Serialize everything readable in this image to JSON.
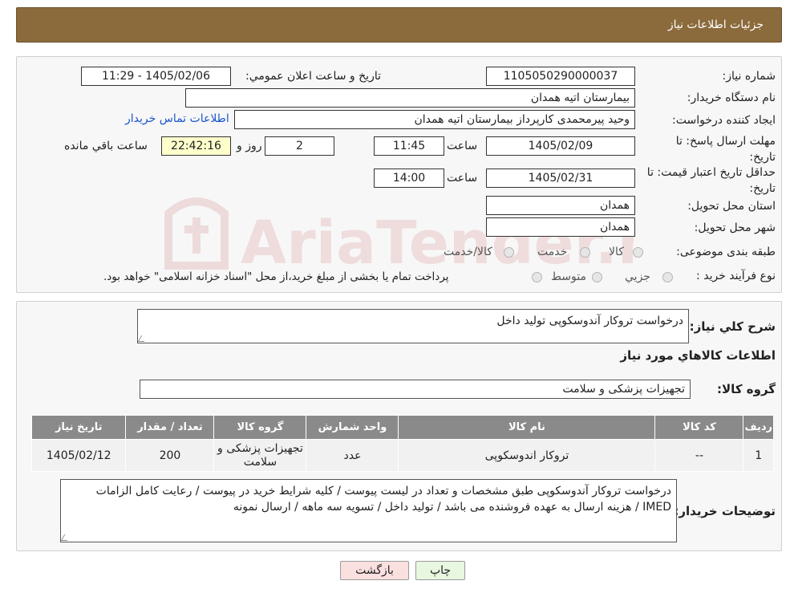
{
  "header": {
    "title": "جزئیات اطلاعات نیاز"
  },
  "form": {
    "need_number_label": "شماره نیاز:",
    "need_number": "1105050290000037",
    "announce_label": "تاريخ و ساعت اعلان عمومي:",
    "announce_value": "1405/02/06 - 11:29",
    "buyer_org_label": "نام دستگاه خريدار:",
    "buyer_org": "بیمارستان اتیه همدان",
    "creator_label": "ايجاد کننده درخواست:",
    "creator": "وحید پیرمحمدی کارپرداز بیمارستان اتیه همدان",
    "contact_link": "اطلاعات تماس خریدار",
    "deadline_label": "مهلت ارسال پاسخ: تا تاريخ:",
    "deadline_date": "1405/02/09",
    "time_label": "ساعت",
    "deadline_time": "11:45",
    "days_value": "2",
    "days_label": "روز و",
    "remaining_time": "22:42:16",
    "remaining_label": "ساعت باقي مانده",
    "validity_label": "حداقل تاريخ اعتبار قيمت: تا تاريخ:",
    "validity_date": "1405/02/31",
    "validity_time": "14:00",
    "province_label": "استان محل تحويل:",
    "province": "همدان",
    "city_label": "شهر محل تحويل:",
    "city": "همدان",
    "category_label": "طبقه بندی موضوعی:",
    "category_options": [
      "کالا",
      "خدمت",
      "کالا/خدمت"
    ],
    "process_label": "نوع فرآيند خريد :",
    "process_options": [
      "جزيي",
      "متوسط"
    ],
    "process_note": "پرداخت تمام يا بخشی از مبلغ خريد،از محل \"اسناد خزانه اسلامی\" خواهد بود."
  },
  "details": {
    "summary_label": "شرح كلي نياز:",
    "summary": "درخواست تروکار آندوسکوپی تولید داخل",
    "goods_title": "اطلاعات كالاهاي مورد نياز",
    "goods_group_label": "گروه كالا:",
    "goods_group": "تجهیزات پزشکی و سلامت"
  },
  "table": {
    "headers": [
      "رديف",
      "كد كالا",
      "نام كالا",
      "واحد شمارش",
      "گروه كالا",
      "تعداد / مقدار",
      "تاريخ نياز"
    ],
    "rows": [
      [
        "1",
        "--",
        "تروکار اندوسکوپی",
        "عدد",
        "تجهیزات پزشکی و سلامت",
        "200",
        "1405/02/12"
      ]
    ]
  },
  "buyer_notes": {
    "label": "توضيحات خريدار:",
    "text": "درخواست تروکار آندوسکوپی طبق مشخصات و تعداد در لیست پیوست / کلیه شرایط خرید در پیوست / رعایت کامل الزامات IMED / هزینه ارسال به عهده فروشنده می باشد / تولید داخل / تسویه سه ماهه / ارسال نمونه"
  },
  "buttons": {
    "print": "چاپ",
    "back": "بازگشت"
  },
  "colors": {
    "header": "#8b6a3b",
    "print_btn": "#e8f7df",
    "back_btn": "#fbe0e0",
    "table_header": "#8a8a8a"
  },
  "watermark": {
    "text": "AriaTender.neT"
  }
}
